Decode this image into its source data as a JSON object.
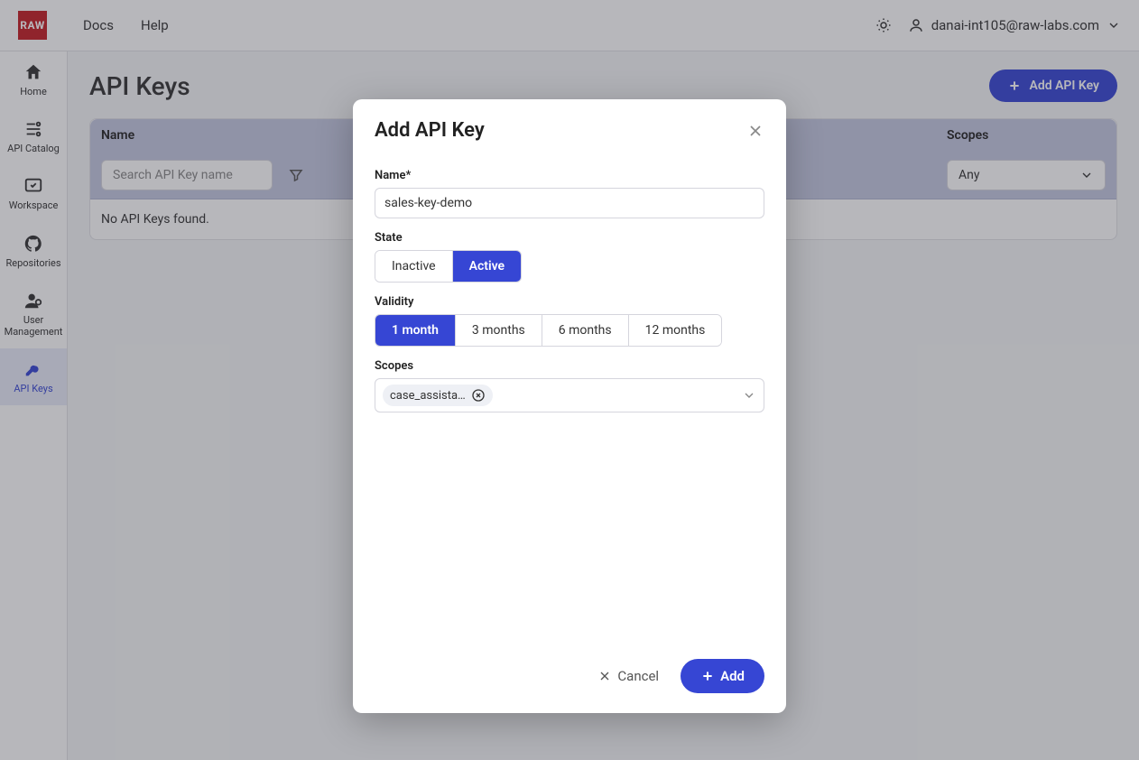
{
  "header": {
    "logo_text": "RAW",
    "links": [
      "Docs",
      "Help"
    ],
    "user_email": "danai-int105@raw-labs.com"
  },
  "sidebar": {
    "items": [
      {
        "label": "Home"
      },
      {
        "label": "API Catalog"
      },
      {
        "label": "Workspace"
      },
      {
        "label": "Repositories"
      },
      {
        "label": "User Management"
      },
      {
        "label": "API Keys"
      }
    ]
  },
  "page": {
    "title": "API Keys",
    "add_button": "Add API Key",
    "columns": {
      "name": "Name",
      "scopes": "Scopes"
    },
    "search_placeholder": "Search API Key name",
    "scopes_filter": "Any",
    "empty_text": "No API Keys found."
  },
  "modal": {
    "title": "Add API Key",
    "name_label": "Name*",
    "name_value": "sales-key-demo",
    "state_label": "State",
    "state_options": [
      "Inactive",
      "Active"
    ],
    "state_active_index": 1,
    "validity_label": "Validity",
    "validity_options": [
      "1 month",
      "3 months",
      "6 months",
      "12 months"
    ],
    "validity_active_index": 0,
    "scopes_label": "Scopes",
    "scope_chip": "case_assista…",
    "cancel": "Cancel",
    "add": "Add"
  }
}
